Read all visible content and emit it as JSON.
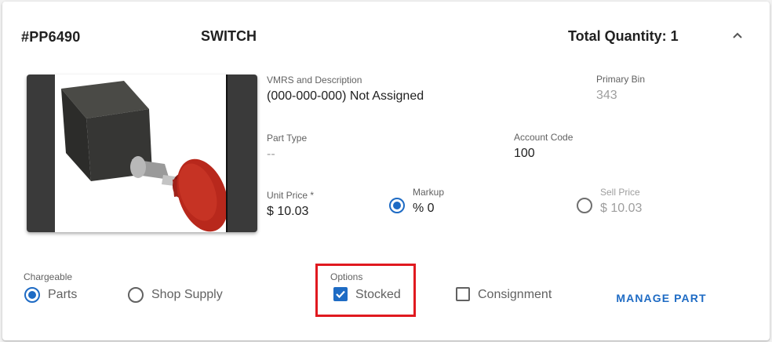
{
  "header": {
    "part_number": "#PP6490",
    "part_name": "SWITCH",
    "total_quantity": "Total Quantity: 1",
    "collapse_icon": "chevron-up-icon"
  },
  "image": {
    "alt": "SWITCH"
  },
  "details": {
    "vmrs_label": "VMRS and Description",
    "vmrs_value": "(000-000-000) Not Assigned",
    "primary_bin_label": "Primary Bin",
    "primary_bin_value": "343",
    "part_type_label": "Part Type",
    "part_type_value": "--",
    "account_code_label": "Account Code",
    "account_code_value": "100",
    "unit_price_label": "Unit Price *",
    "unit_price_value": "$ 10.03",
    "markup_label": "Markup",
    "markup_value": "% 0",
    "markup_selected": true,
    "sell_price_label": "Sell Price",
    "sell_price_value": "$ 10.03",
    "sell_price_selected": false
  },
  "chargeable": {
    "label": "Chargeable",
    "options": [
      {
        "label": "Parts",
        "selected": true
      },
      {
        "label": "Shop Supply",
        "selected": false
      }
    ]
  },
  "options": {
    "label": "Options",
    "stocked_label": "Stocked",
    "stocked_checked": true,
    "consignment_label": "Consignment",
    "consignment_checked": false
  },
  "actions": {
    "manage_part_label": "MANAGE PART"
  },
  "colors": {
    "accent": "#1e6bc4",
    "highlight": "#e0191f",
    "muted": "#9e9e9e"
  }
}
